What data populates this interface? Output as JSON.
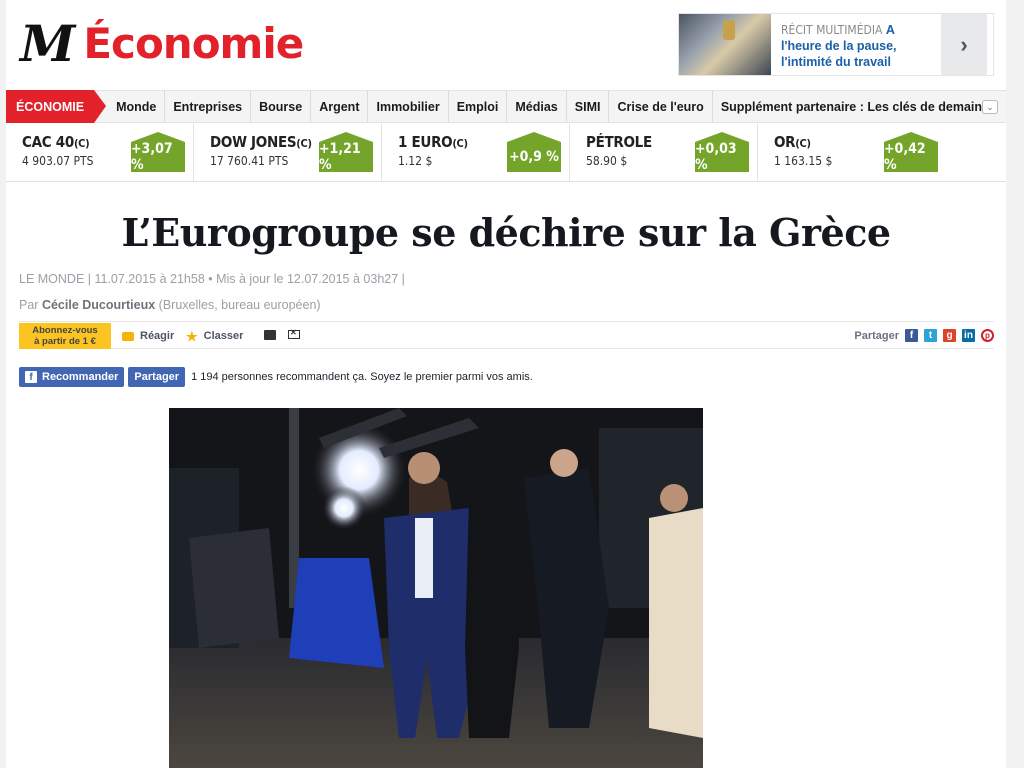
{
  "masthead": {
    "logo": "M",
    "section_title": "Économie"
  },
  "promo": {
    "kicker": "RÉCIT MULTIMÉDIA",
    "headline": "A l'heure de la pause, l'intimité du travail"
  },
  "nav": {
    "active": "ÉCONOMIE",
    "items": [
      "Monde",
      "Entreprises",
      "Bourse",
      "Argent",
      "Immobilier",
      "Emploi",
      "Médias",
      "SIMI",
      "Crise de l'euro",
      "Supplément partenaire : Les clés de demain"
    ]
  },
  "ticker": [
    {
      "name": "CAC 40",
      "suffix": "(C)",
      "value": "4 903.07 PTS",
      "change": "+3,07 %"
    },
    {
      "name": "DOW JONES",
      "suffix": "(C)",
      "value": "17 760.41 PTS",
      "change": "+1,21 %"
    },
    {
      "name": "1 EURO",
      "suffix": "(C)",
      "value": "1.12 $",
      "change": "+0,9 %"
    },
    {
      "name": "PÉTROLE",
      "suffix": "",
      "value": "58.90 $",
      "change": "+0,03 %"
    },
    {
      "name": "OR",
      "suffix": "(C)",
      "value": "1 163.15 $",
      "change": "+0,42 %"
    }
  ],
  "article": {
    "headline": "L’Eurogroupe se déchire sur la Grèce",
    "meta": "LE MONDE | 11.07.2015 à 21h58 • Mis à jour le 12.07.2015 à 03h27 |",
    "byline_prefix": "Par",
    "author": "Cécile Ducourtieux",
    "author_note": "(Bruxelles, bureau européen)"
  },
  "toolbar": {
    "subscribe_line1": "Abonnez-vous",
    "subscribe_line2": "à partir de 1 €",
    "react": "Réagir",
    "classer": "Classer",
    "share_label": "Partager"
  },
  "facebook": {
    "recommend": "Recommander",
    "share": "Partager",
    "text": "1 194 personnes recommandent ça. Soyez le premier parmi vos amis."
  }
}
